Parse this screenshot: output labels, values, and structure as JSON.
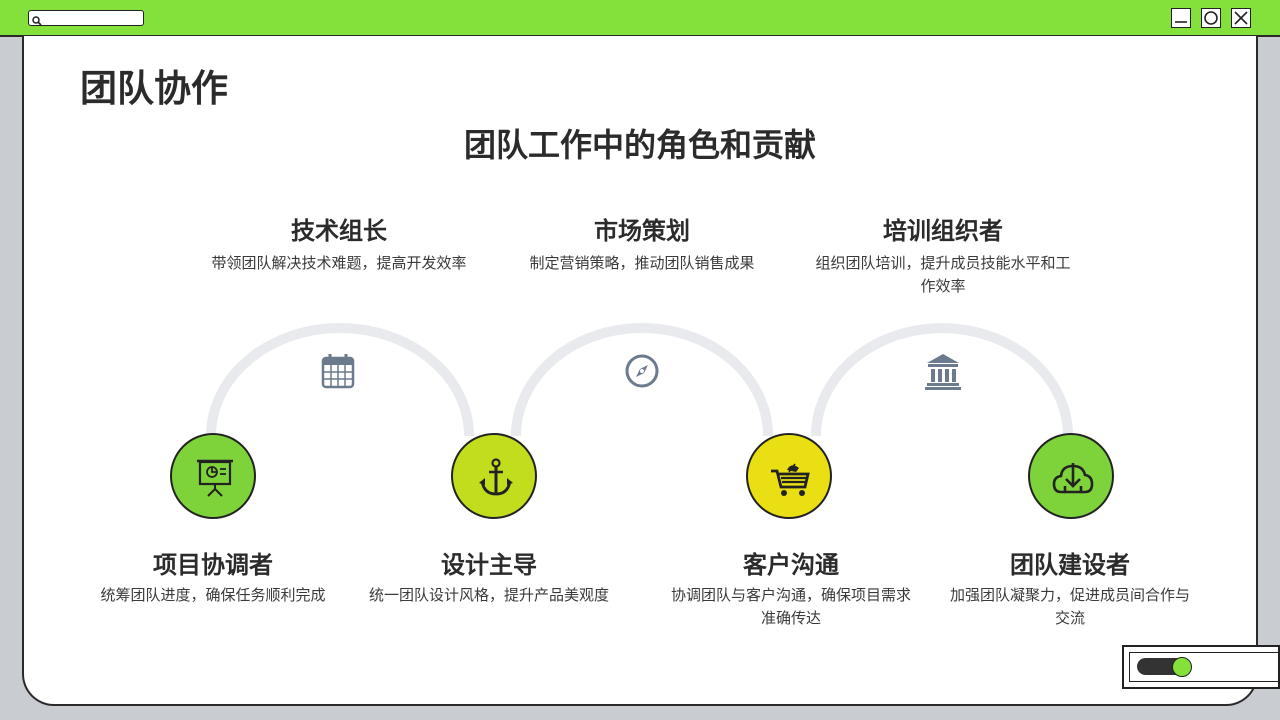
{
  "window": {
    "search_value": "",
    "accent_color": "#84e03a"
  },
  "page": {
    "title": "团队协作",
    "subtitle": "团队工作中的角色和贡献"
  },
  "top_roles": [
    {
      "title": "技术组长",
      "desc": "带领团队解决技术难题，提高开发效率"
    },
    {
      "title": "市场策划",
      "desc": "制定营销策略，推动团队销售成果"
    },
    {
      "title": "培训组织者",
      "desc_line1": "组织团队培训，提升成员技能水平和工",
      "desc_line2": "作效率"
    }
  ],
  "bottom_roles": [
    {
      "title": "项目协调者",
      "desc": "统筹团队进度，确保任务顺利完成",
      "icon": "presentation-board-icon",
      "color": "#7ed33a"
    },
    {
      "title": "设计主导",
      "desc": "统一团队设计风格，提升产品美观度",
      "icon": "anchor-icon",
      "color": "#c2dc1e"
    },
    {
      "title": "客户沟通",
      "desc_line1": "协调团队与客户沟通，确保项目需求",
      "desc_line2": "准确传达",
      "icon": "shopping-cart-icon",
      "color": "#eadf12"
    },
    {
      "title": "团队建设者",
      "desc_line1": "加强团队凝聚力，促进成员间合作与",
      "desc_line2": "交流",
      "icon": "cloud-download-icon",
      "color": "#7ed33a"
    }
  ],
  "arc_icons": [
    "calendar-icon",
    "compass-icon",
    "bank-icon"
  ],
  "colors": {
    "arc": "#e8eaed",
    "arc_icon": "#6b7a8c",
    "text": "#2b2b2b"
  }
}
